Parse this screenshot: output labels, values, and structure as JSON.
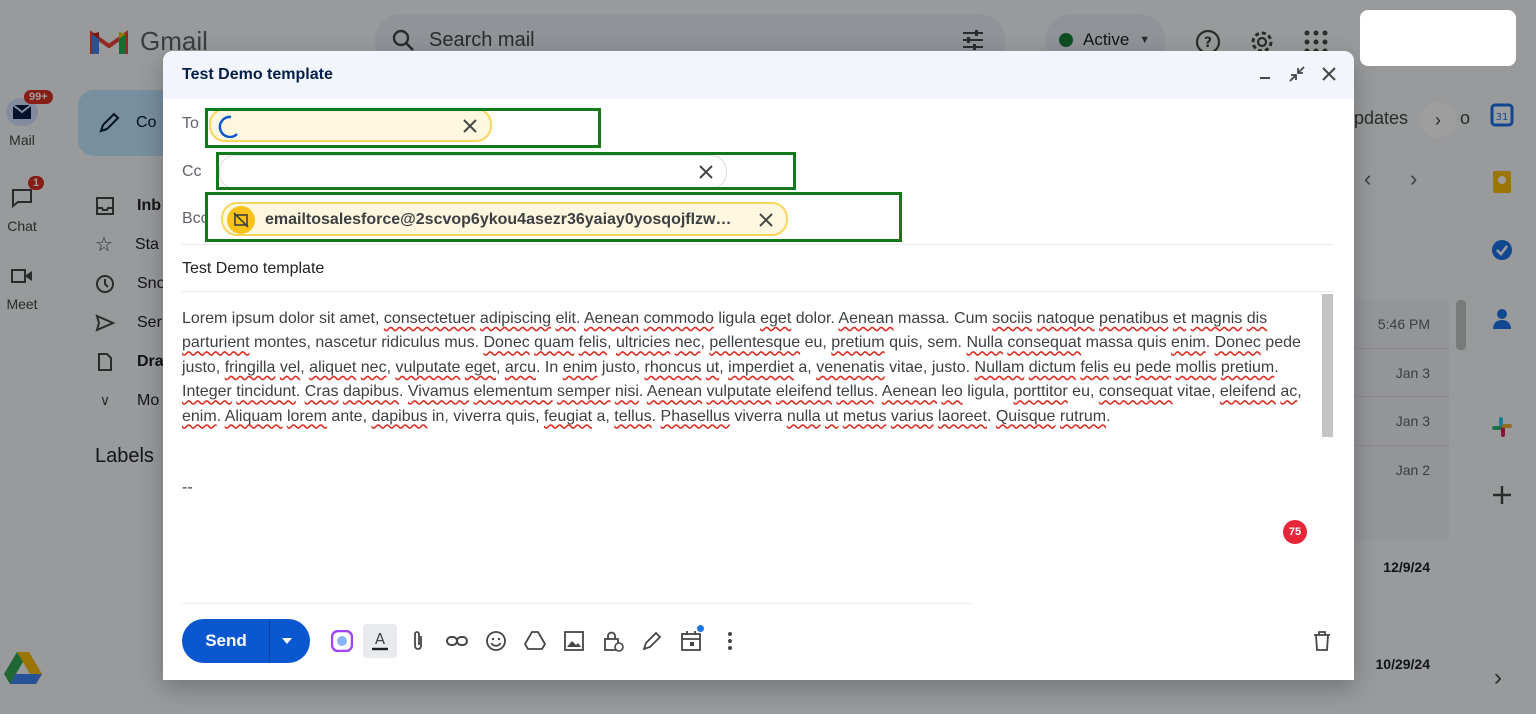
{
  "gmail": {
    "logo_text": "Gmail",
    "search_placeholder": "Search mail",
    "status": "Active"
  },
  "rail": [
    {
      "label": "Mail",
      "badge": "99+"
    },
    {
      "label": "Chat",
      "badge": "1"
    },
    {
      "label": "Meet",
      "badge": ""
    }
  ],
  "sidebar": {
    "compose_label": "Co",
    "items": [
      "Inb",
      "Sta",
      "Sno",
      "Ser",
      "Dra",
      "Mo"
    ],
    "labels_heading": "Labels"
  },
  "inbox": {
    "tab_label": "pdates",
    "tab_label_2": "o",
    "dates": [
      "5:46 PM",
      "Jan 3",
      "Jan 3",
      "Jan 2",
      "12/9/24",
      "10/29/24"
    ]
  },
  "compose": {
    "title": "Test Demo template",
    "to_label": "To",
    "cc_label": "Cc",
    "bcc_label": "Bcc",
    "bcc_recipient": "emailtosalesforce@2scvop6ykou4asezr36yaiay0yosqojflzw…",
    "subject": "Test Demo template",
    "signature": "--",
    "spell_count": "75",
    "send_label": "Send"
  },
  "colors": {
    "accent": "#0b57d0",
    "highlight_box": "#137a1b",
    "spell_underline": "#d93025"
  }
}
